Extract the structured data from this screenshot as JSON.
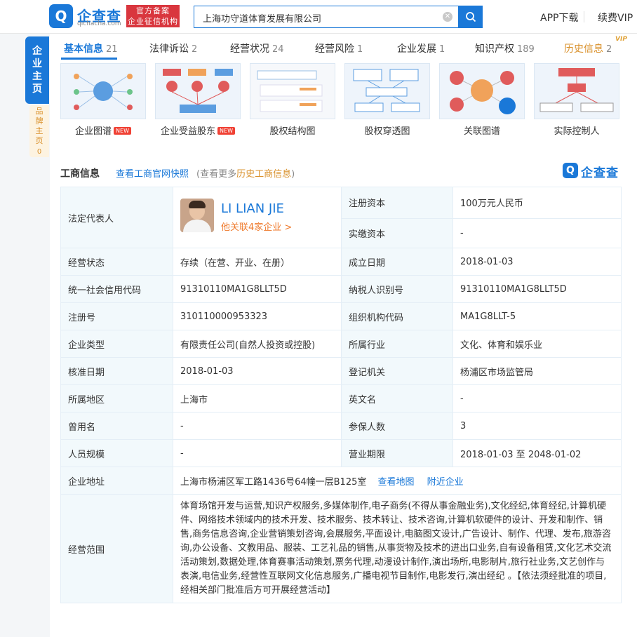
{
  "header": {
    "logo_mark": "Q",
    "logo_name": "企查查",
    "logo_domain": "qichacha.com",
    "badge_line1": "官方备案",
    "badge_line2": "企业征信机构",
    "search_value": "上海功守道体育发展有限公司",
    "app_download": "APP下载",
    "renew_vip": "续费VIP"
  },
  "side": {
    "main_tab": [
      "企",
      "业",
      "主",
      "页"
    ],
    "brand_tab": [
      "品",
      "牌",
      "主",
      "页"
    ],
    "brand_count": "0"
  },
  "tabs": [
    {
      "label": "基本信息",
      "count": "21"
    },
    {
      "label": "法律诉讼",
      "count": "2"
    },
    {
      "label": "经营状况",
      "count": "24"
    },
    {
      "label": "经营风险",
      "count": "1"
    },
    {
      "label": "企业发展",
      "count": "1"
    },
    {
      "label": "知识产权",
      "count": "189"
    },
    {
      "label": "历史信息",
      "count": "2"
    }
  ],
  "vip_tag": "VIP",
  "graphs": [
    {
      "label": "企业图谱",
      "new": "NEW"
    },
    {
      "label": "企业受益股东",
      "new": "NEW"
    },
    {
      "label": "股权结构图",
      "new": ""
    },
    {
      "label": "股权穿透图",
      "new": ""
    },
    {
      "label": "关联图谱",
      "new": ""
    },
    {
      "label": "实际控制人",
      "new": ""
    }
  ],
  "section": {
    "title": "工商信息",
    "snapshot_link": "查看工商官网快照",
    "more_prefix": "(查看更多",
    "more_link": "历史工商信息",
    "more_suffix": ")",
    "brand_name": "企查查"
  },
  "legal_rep": {
    "label": "法定代表人",
    "name": "LI LIAN JIE",
    "related": "他关联4家企业 >"
  },
  "rows": {
    "reg_capital_k": "注册资本",
    "reg_capital_v": "100万元人民币",
    "paid_capital_k": "实缴资本",
    "paid_capital_v": "-",
    "status_k": "经营状态",
    "status_v": "存续（在营、开业、在册）",
    "found_k": "成立日期",
    "found_v": "2018-01-03",
    "credit_k": "统一社会信用代码",
    "credit_v": "91310110MA1G8LLT5D",
    "tax_k": "纳税人识别号",
    "tax_v": "91310110MA1G8LLT5D",
    "regno_k": "注册号",
    "regno_v": "310110000953323",
    "org_k": "组织机构代码",
    "org_v": "MA1G8LLT-5",
    "type_k": "企业类型",
    "type_v": "有限责任公司(自然人投资或控股)",
    "industry_k": "所属行业",
    "industry_v": "文化、体育和娱乐业",
    "approve_k": "核准日期",
    "approve_v": "2018-01-03",
    "authority_k": "登记机关",
    "authority_v": "杨浦区市场监管局",
    "region_k": "所属地区",
    "region_v": "上海市",
    "english_k": "英文名",
    "english_v": "-",
    "former_k": "曾用名",
    "former_v": "-",
    "insured_k": "参保人数",
    "insured_v": "3",
    "staff_k": "人员规模",
    "staff_v": "-",
    "term_k": "营业期限",
    "term_v": "2018-01-03 至 2048-01-02",
    "address_k": "企业地址",
    "address_v": "上海市杨浦区军工路1436号64幢一层B125室",
    "map_link": "查看地图",
    "nearby_link": "附近企业",
    "scope_k": "经营范围",
    "scope_v": "体育场馆开发与运营,知识产权服务,多媒体制作,电子商务(不得从事金融业务),文化经纪,体育经纪,计算机硬件、网络技术领域内的技术开发、技术服务、技术转让、技术咨询,计算机软硬件的设计、开发和制作、销售,商务信息咨询,企业营销策划咨询,会展服务,平面设计,电脑图文设计,广告设计、制作、代理、发布,旅游咨询,办公设备、文教用品、服装、工艺礼品的销售,从事货物及技术的进出口业务,自有设备租赁,文化艺术交流活动策划,数据处理,体育赛事活动策划,票务代理,动漫设计制作,演出场所,电影制片,旅行社业务,文艺创作与表演,电信业务,经营性互联网文化信息服务,广播电视节目制作,电影发行,演出经纪 。【依法须经批准的项目,经相关部门批准后方可开展经营活动】"
  },
  "colors": {
    "brand": "#1a78d8",
    "accent_orange": "#ef7a2c",
    "gold": "#d9902a",
    "badge_red": "#d9363e"
  }
}
